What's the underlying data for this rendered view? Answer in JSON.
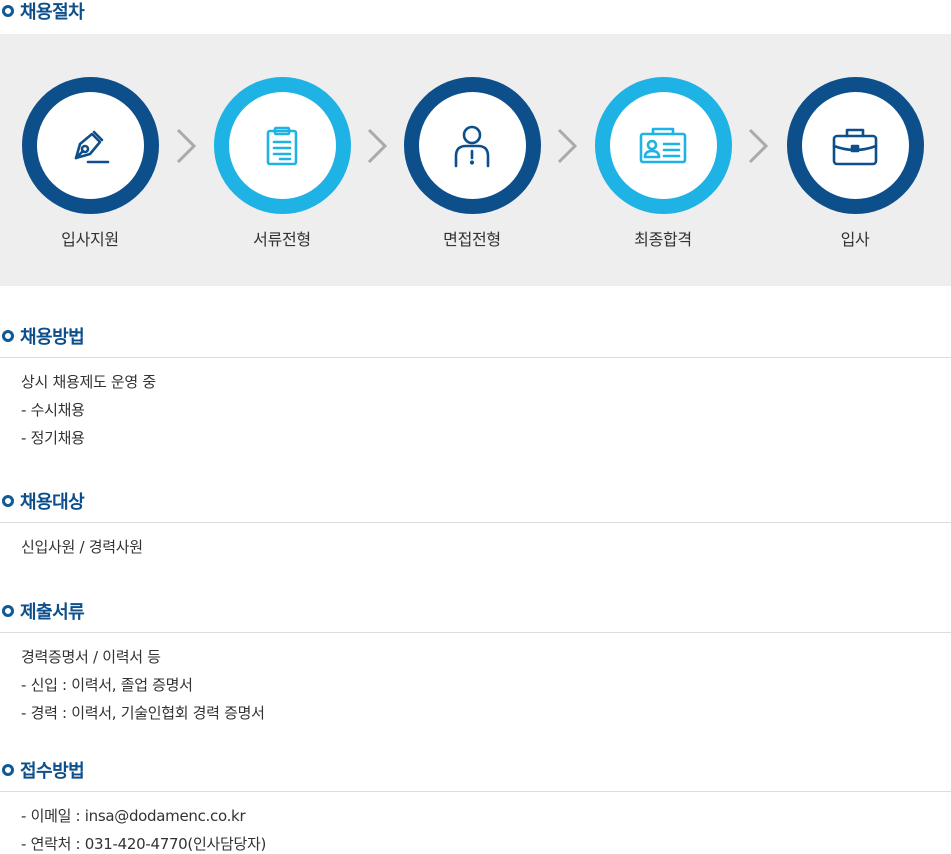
{
  "process": {
    "title": "채용절차",
    "steps": [
      {
        "label": "입사지원",
        "icon": "pen-nib-icon"
      },
      {
        "label": "서류전형",
        "icon": "clipboard-icon"
      },
      {
        "label": "면접전형",
        "icon": "person-icon"
      },
      {
        "label": "최종합격",
        "icon": "id-card-icon"
      },
      {
        "label": "입사",
        "icon": "briefcase-icon"
      }
    ]
  },
  "method": {
    "title": "채용방법",
    "lines": [
      "상시 채용제도 운영 중",
      "- 수시채용",
      "- 정기채용"
    ]
  },
  "target": {
    "title": "채용대상",
    "lines": [
      "신입사원 / 경력사원"
    ]
  },
  "documents": {
    "title": "제출서류",
    "lines": [
      "경력증명서 / 이력서 등",
      "- 신입 : 이력서, 졸업 증명서",
      "- 경력 : 이력서, 기술인협회 경력 증명서"
    ]
  },
  "apply": {
    "title": "접수방법",
    "lines": [
      "- 이메일 : insa@dodamenc.co.kr",
      "- 연락처 : 031-420-4770(인사담당자)"
    ]
  },
  "colors": {
    "dark_blue": "#0d4f8b",
    "light_blue": "#1fb2e4",
    "panel_bg": "#eeeeee",
    "arrow": "#aaaaaa"
  }
}
